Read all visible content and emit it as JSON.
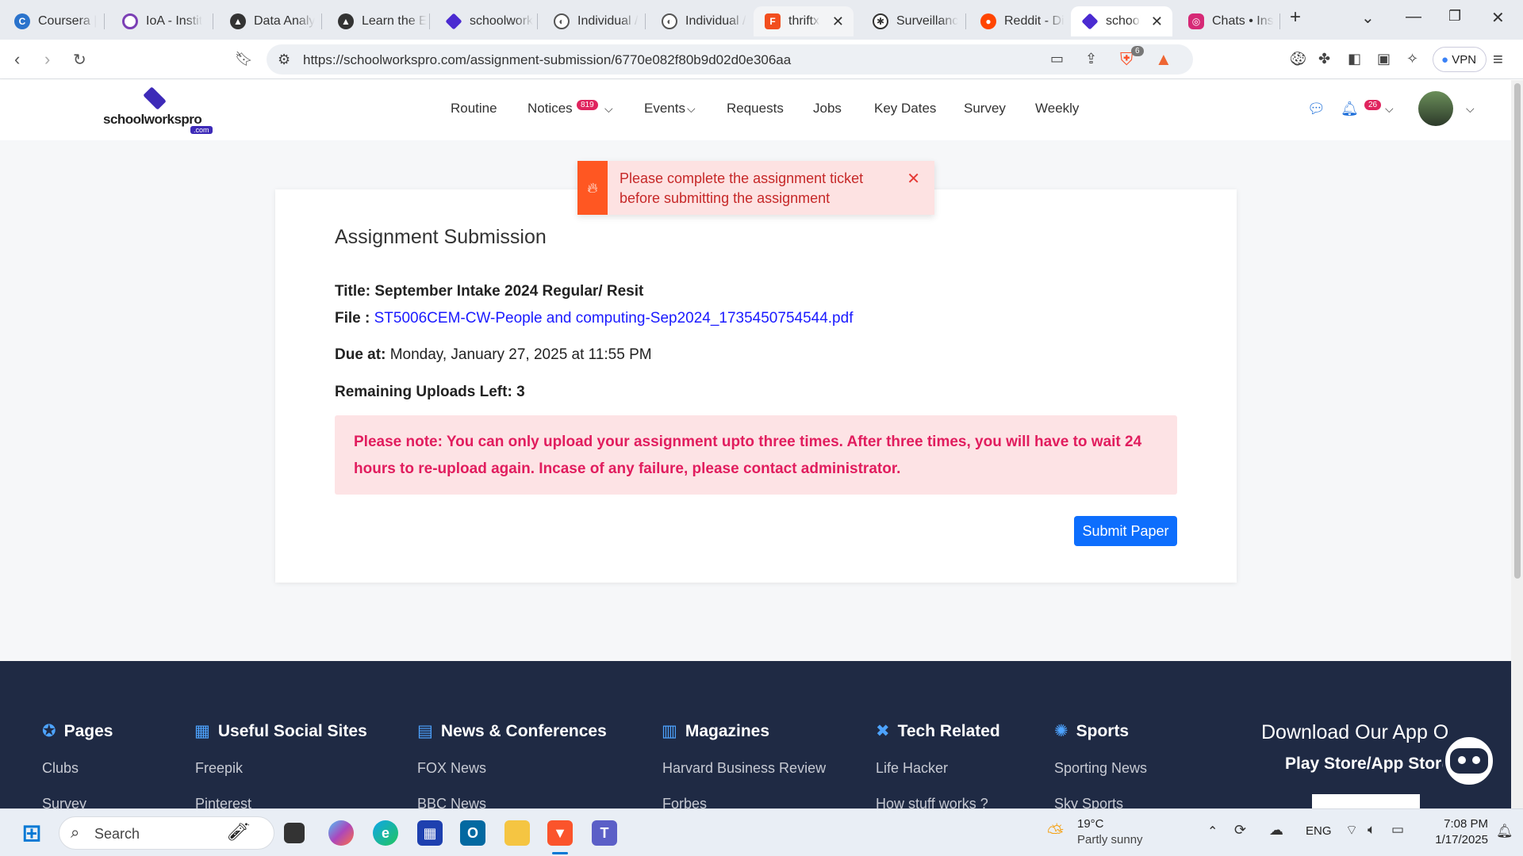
{
  "browser": {
    "tabs": [
      {
        "title": "Coursera |",
        "favicon": "coursera-icon",
        "color": "#2a73cc"
      },
      {
        "title": "IoA - Instit",
        "favicon": "ioa-icon",
        "color": "#7b3fb5"
      },
      {
        "title": "Data Analy",
        "favicon": "data-icon",
        "color": "#333333"
      },
      {
        "title": "Learn the E",
        "favicon": "learn-icon",
        "color": "#333333"
      },
      {
        "title": "schoolwork",
        "favicon": "schoolworks-icon",
        "color": "#4b2bd1"
      },
      {
        "title": "Individual /",
        "favicon": "globe-icon",
        "color": "#555555"
      },
      {
        "title": "Individual /",
        "favicon": "globe-icon",
        "color": "#555555"
      },
      {
        "title": "thriftx",
        "favicon": "figma-icon",
        "color": "#f24e1e"
      },
      {
        "title": "Surveillanc",
        "favicon": "openai-icon",
        "color": "#333333"
      },
      {
        "title": "Reddit - Di",
        "favicon": "reddit-icon",
        "color": "#ff4500"
      },
      {
        "title": "school",
        "favicon": "schoolworks-icon",
        "color": "#4b2bd1"
      },
      {
        "title": "Chats • Ins",
        "favicon": "instagram-icon",
        "color": "#d62976"
      }
    ],
    "url": "https://schoolworkspro.com/assignment-submission/6770e082f80b9d02d0e306aa",
    "brave_badge": "6",
    "vpn_label": "VPN"
  },
  "site": {
    "logo_text": "schoolworkspro",
    "logo_sub": ".com",
    "menu": [
      "Routine",
      "Notices",
      "Events",
      "Requests",
      "Jobs",
      "Key Dates",
      "Survey",
      "Weekly"
    ],
    "notices_badge": "819",
    "bell_badge": "26"
  },
  "toast": {
    "message": "Please complete the assignment ticket before submitting the assignment"
  },
  "card": {
    "heading": "Assignment Submission",
    "title_label": "Title:",
    "title_value": "September Intake 2024 Regular/ Resit",
    "file_label": "File :",
    "file_value": "ST5006CEM-CW-People and computing-Sep2024_1735450754544.pdf",
    "due_label": "Due at:",
    "due_value": "Monday, January 27, 2025 at 11:55 PM",
    "remaining": "Remaining Uploads Left: 3",
    "note": "Please note: You can only upload your assignment upto three times. After three times, you will have to wait 24 hours to re-upload again. Incase of any failure, please contact administrator.",
    "submit": "Submit Paper"
  },
  "footer": {
    "columns": [
      {
        "heading": "Pages",
        "icon": "dharma-wheel-icon",
        "links": [
          "Clubs",
          "Survey"
        ]
      },
      {
        "heading": "Useful Social Sites",
        "icon": "apps-icon",
        "links": [
          "Freepik",
          "Pinterest"
        ]
      },
      {
        "heading": "News & Conferences",
        "icon": "newspaper-icon",
        "links": [
          "FOX News",
          "BBC News"
        ]
      },
      {
        "heading": "Magazines",
        "icon": "books-icon",
        "links": [
          "Harvard Business Review",
          "Forbes"
        ]
      },
      {
        "heading": "Tech Related",
        "icon": "tools-icon",
        "links": [
          "Life Hacker",
          "How stuff works ?"
        ]
      },
      {
        "heading": "Sports",
        "icon": "ball-icon",
        "links": [
          "Sporting News",
          "Sky Sports"
        ]
      }
    ],
    "app_heading": "Download Our App O",
    "app_sub": "Play Store/App Store"
  },
  "taskbar": {
    "search": "Search",
    "weather_temp": "19°C",
    "weather_desc": "Partly sunny",
    "lang": "ENG",
    "time": "7:08 PM",
    "date": "1/17/2025"
  }
}
